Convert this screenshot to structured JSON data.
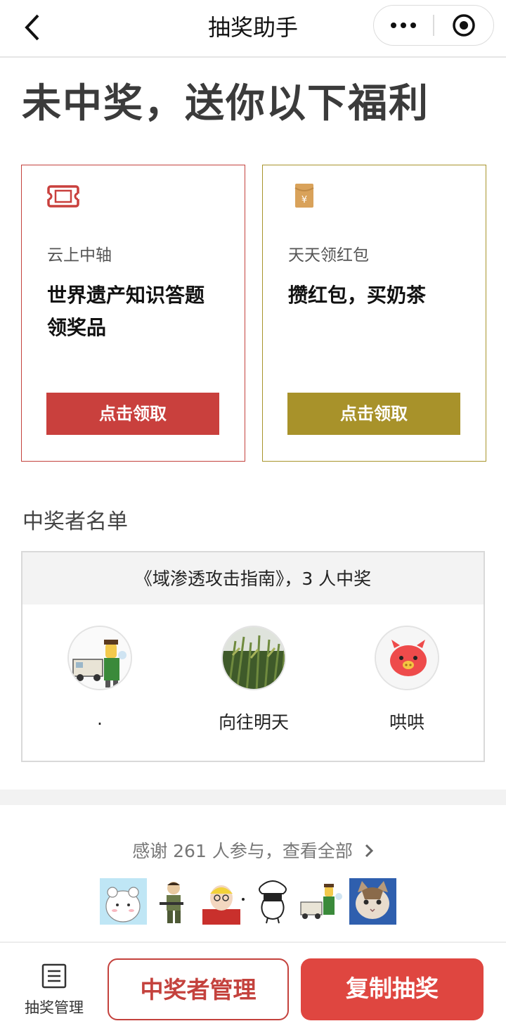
{
  "nav": {
    "title": "抽奖助手",
    "back_icon": "chevron-left-icon",
    "more_icon": "more-dots-icon",
    "close_icon": "target-icon"
  },
  "headline": "未中奖，送你以下福利",
  "cards": [
    {
      "icon": "ticket-icon",
      "label": "云上中轴",
      "desc_line1": "世界遗产知识答题",
      "desc_line2": "领奖品",
      "button": "点击领取",
      "color": "#c9403d"
    },
    {
      "icon": "red-envelope-icon",
      "label": "天天领红包",
      "desc_line1": "攒红包，买奶茶",
      "desc_line2": "",
      "button": "点击领取",
      "color": "#a8922a"
    }
  ],
  "winners": {
    "section_title": "中奖者名单",
    "header": "《域渗透攻击指南》，3 人中奖",
    "list": [
      {
        "name": ".",
        "avatar": "cartoon-man-avatar"
      },
      {
        "name": "向往明天",
        "avatar": "rice-field-avatar"
      },
      {
        "name": "哄哄",
        "avatar": "pig-avatar"
      }
    ]
  },
  "participants": {
    "thanks": "感谢 261 人参与，查看全部",
    "avatars": [
      "bear-avatar",
      "soldier-avatar",
      "cartoon-face-avatar",
      "sheep-avatar",
      "cartoon-man-avatar",
      "cat-avatar"
    ]
  },
  "bottom_bar": {
    "manage_label": "抽奖管理",
    "manage_icon": "list-icon",
    "winners_manage": "中奖者管理",
    "copy": "复制抽奖",
    "accent": "#df4640"
  }
}
